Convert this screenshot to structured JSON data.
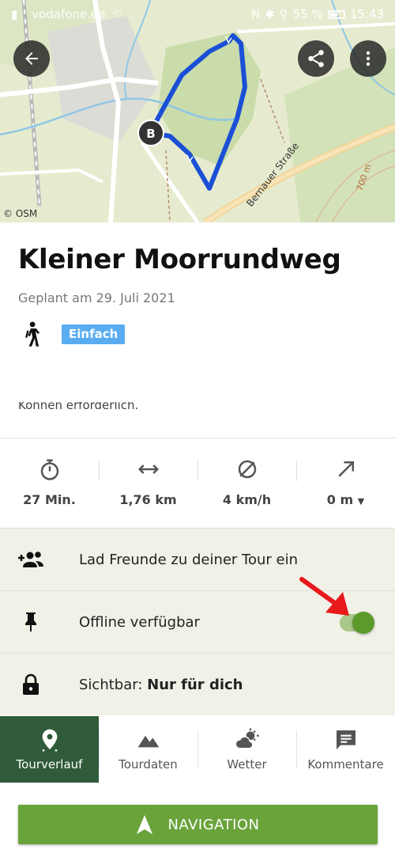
{
  "status_bar": {
    "carrier": "vodafone.de",
    "battery": "55 %",
    "time": "15:43"
  },
  "map": {
    "attribution": "© OSM",
    "street_label": "Bernauer Straße",
    "elevation_label": "700 m",
    "marker_label": "B",
    "route_color": "#1a4fd6",
    "icons": [
      "arrow-left-icon",
      "share-icon",
      "more-vert-icon"
    ]
  },
  "tour": {
    "title": "Kleiner Moorrundweg",
    "planned": "Geplant am 29. Juli 2021",
    "difficulty": "Einfach",
    "sport_icon": "hiking-icon",
    "description_fragment": "Können erforderlich."
  },
  "stats": [
    {
      "icon": "stopwatch-icon",
      "value": "27 Min."
    },
    {
      "icon": "distance-icon",
      "value": "1,76 km"
    },
    {
      "icon": "speed-icon",
      "value": "4 km/h"
    },
    {
      "icon": "elevation-icon",
      "value": "0 m"
    }
  ],
  "options": {
    "invite_label": "Lad Freunde zu deiner Tour ein",
    "offline_label": "Offline verfügbar",
    "offline_enabled": true,
    "visibility_prefix": "Sichtbar:",
    "visibility_value": "Nur für dich"
  },
  "tabs": [
    {
      "label": "Tourverlauf",
      "icon": "location-pin-icon",
      "active": true
    },
    {
      "label": "Tourdaten",
      "icon": "mountain-icon",
      "active": false
    },
    {
      "label": "Wetter",
      "icon": "weather-icon",
      "active": false
    },
    {
      "label": "Kommentare",
      "icon": "comment-icon",
      "active": false
    }
  ],
  "navigation_button": "NAVIGATION",
  "colors": {
    "accent": "#6aa33a",
    "active_tab": "#2f5b3a",
    "badge": "#5aacf0",
    "annotation_arrow": "#e8181b"
  }
}
